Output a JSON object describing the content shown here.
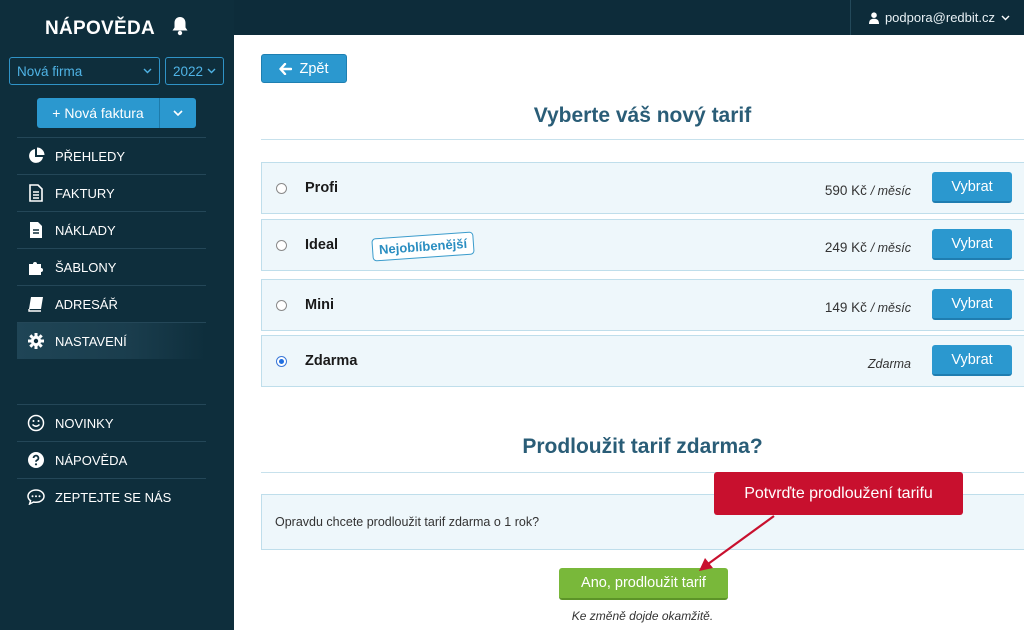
{
  "sidebar": {
    "title": "NÁPOVĚDA",
    "firm_select": "Nová firma",
    "year_select": "2022",
    "new_invoice_label": "+ Nová faktura",
    "nav_main": [
      {
        "label": "PŘEHLEDY",
        "icon": "pie-chart-icon"
      },
      {
        "label": "FAKTURY",
        "icon": "invoice-icon"
      },
      {
        "label": "NÁKLADY",
        "icon": "expenses-icon"
      },
      {
        "label": "ŠABLONY",
        "icon": "puzzle-icon"
      },
      {
        "label": "ADRESÁŘ",
        "icon": "address-book-icon"
      },
      {
        "label": "NASTAVENÍ",
        "icon": "gear-icon",
        "active": true
      }
    ],
    "nav_secondary": [
      {
        "label": "NOVINKY",
        "icon": "smiley-icon"
      },
      {
        "label": "NÁPOVĚDA",
        "icon": "question-icon"
      },
      {
        "label": "ZEPTEJTE SE NÁS",
        "icon": "chat-icon"
      }
    ]
  },
  "header": {
    "user_email": "podpora@redbit.cz"
  },
  "main": {
    "back_label": "Zpět",
    "title_choose": "Vyberte váš nový tarif",
    "plans": [
      {
        "name": "Profi",
        "price": "590 Kč",
        "period": "/ měsíc",
        "button": "Vybrat",
        "selected": false
      },
      {
        "name": "Ideal",
        "price": "249 Kč",
        "period": "/ měsíc",
        "button": "Vybrat",
        "selected": false,
        "badge": "Nejoblíbenější"
      },
      {
        "name": "Mini",
        "price": "149 Kč",
        "period": "/ měsíc",
        "button": "Vybrat",
        "selected": false
      },
      {
        "name": "Zdarma",
        "price": "",
        "period": "Zdarma",
        "button": "Vybrat",
        "selected": true
      }
    ],
    "title_extend": "Prodloužit tarif zdarma?",
    "confirm_question": "Opravdu chcete prodloužit tarif zdarma o 1 rok?",
    "extend_button": "Ano, prodloužit tarif",
    "note": "Ke změně dojde okamžitě."
  },
  "annotation": {
    "callout_text": "Potvrďte prodloužení tarifu",
    "color": "#c8102e"
  },
  "colors": {
    "sidebar_bg": "#0e2e3c",
    "accent_blue": "#2b98cf",
    "confirm_green": "#79b83a"
  }
}
